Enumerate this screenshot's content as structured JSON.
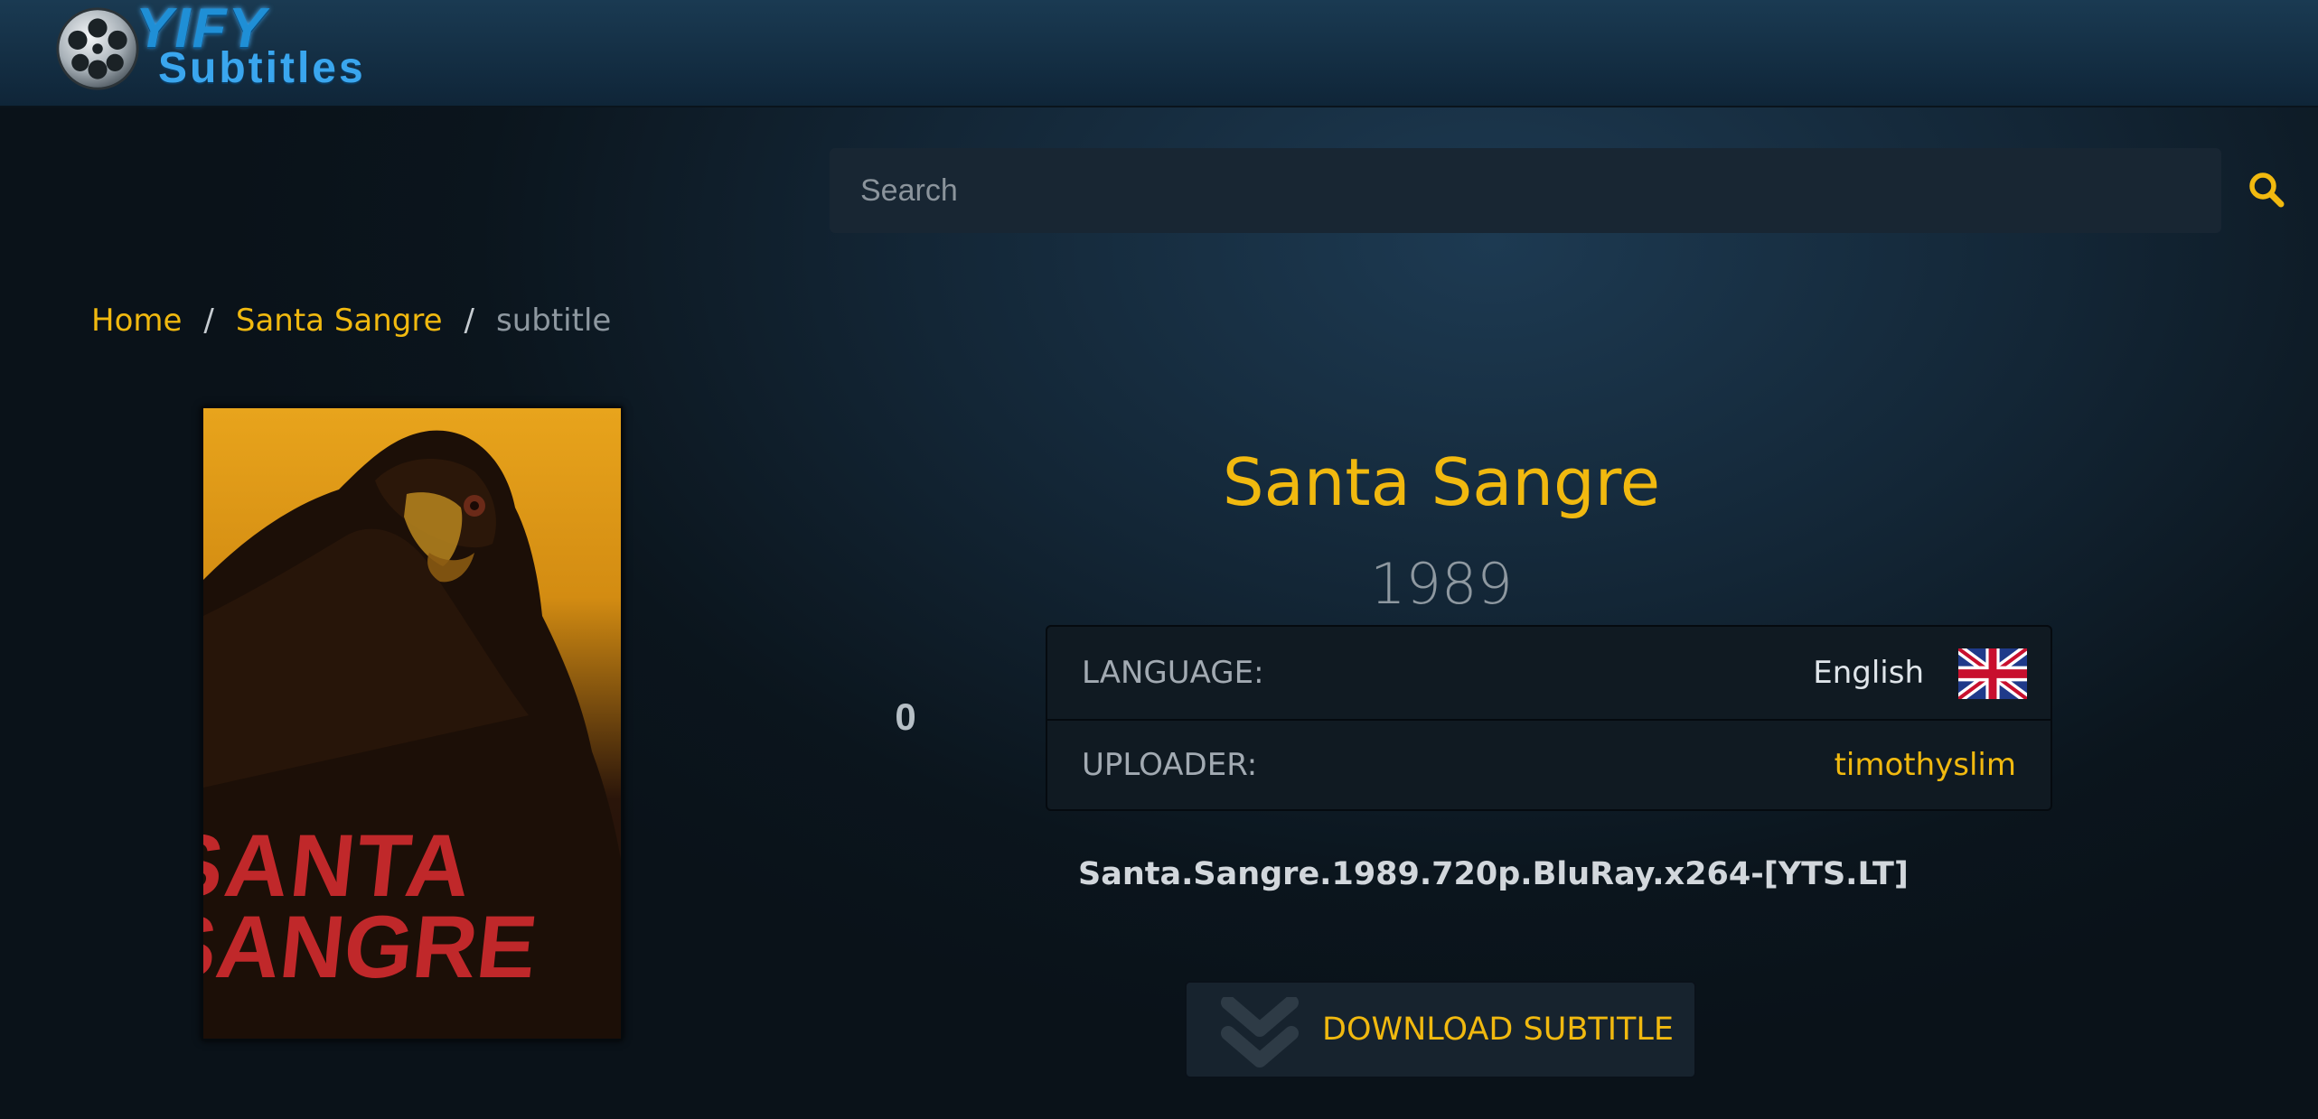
{
  "site": {
    "logo_line1": "YIFY",
    "logo_line2": "Subtitles"
  },
  "search": {
    "placeholder": "Search"
  },
  "breadcrumb": {
    "home": "Home",
    "movie": "Santa Sangre",
    "current": "subtitle",
    "separator": "/"
  },
  "poster": {
    "line1": "SANTA",
    "line2": "SANGRE"
  },
  "movie": {
    "title": "Santa Sangre",
    "year": "1989",
    "rating": "0"
  },
  "info": {
    "language_label": "LANGUAGE:",
    "language_value": "English",
    "uploader_label": "UPLOADER:",
    "uploader_value": "timothyslim"
  },
  "release": {
    "name": "Santa.Sangre.1989.720p.BluRay.x264-[YTS.LT]"
  },
  "download": {
    "label": "DOWNLOAD SUBTITLE"
  },
  "colors": {
    "accent": "#f1b90f",
    "background": "#0b141b",
    "header": "#1a3a52"
  },
  "icons": {
    "search": "magnifier-icon",
    "download": "double-chevron-down-icon",
    "flag": "uk-flag-icon"
  }
}
